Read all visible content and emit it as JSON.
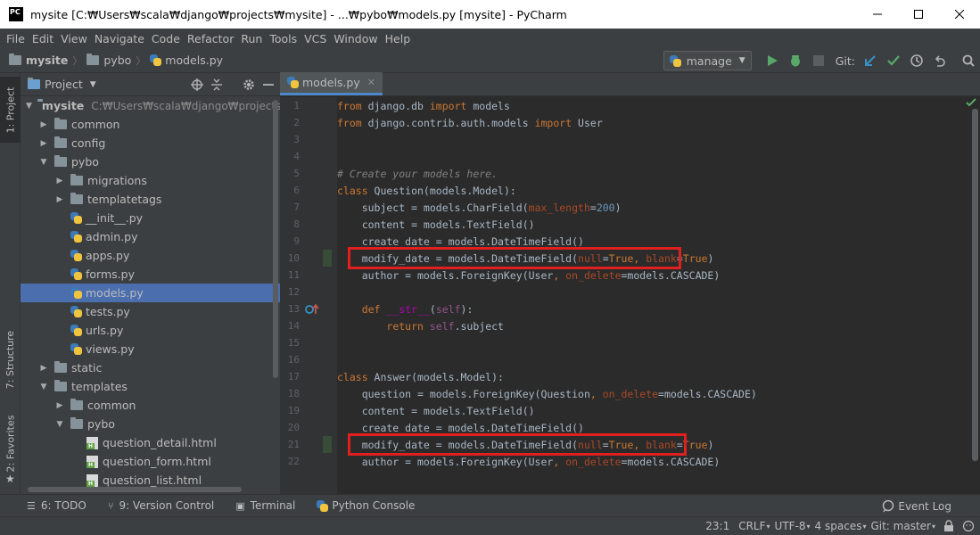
{
  "window": {
    "app_icon": "PC",
    "title": "mysite [C:₩Users₩scala₩django₩projects₩mysite] - ...₩pybo₩models.py [mysite] - PyCharm"
  },
  "menu": [
    "File",
    "Edit",
    "View",
    "Navigate",
    "Code",
    "Refactor",
    "Run",
    "Tools",
    "VCS",
    "Window",
    "Help"
  ],
  "breadcrumb": [
    "mysite",
    "pybo",
    "models.py"
  ],
  "toolbar": {
    "run_config": "manage",
    "git_label": "Git:"
  },
  "left_strip": {
    "project": "1: Project",
    "structure": "7: Structure",
    "favorites": "2: Favorites"
  },
  "project_panel": {
    "title": "Project",
    "root": {
      "name": "mysite",
      "path": "C:₩Users₩scala₩django₩projects₩mys"
    },
    "items": [
      {
        "label": "common"
      },
      {
        "label": "config"
      },
      {
        "label": "pybo"
      },
      {
        "label": "migrations"
      },
      {
        "label": "templatetags"
      },
      {
        "label": "__init__.py"
      },
      {
        "label": "admin.py"
      },
      {
        "label": "apps.py"
      },
      {
        "label": "forms.py"
      },
      {
        "label": "models.py"
      },
      {
        "label": "tests.py"
      },
      {
        "label": "urls.py"
      },
      {
        "label": "views.py"
      },
      {
        "label": "static"
      },
      {
        "label": "templates"
      },
      {
        "label": "common"
      },
      {
        "label": "pybo"
      },
      {
        "label": "question_detail.html"
      },
      {
        "label": "question_form.html"
      },
      {
        "label": "question_list.html"
      }
    ]
  },
  "editor": {
    "tab": "models.py",
    "line_numbers": [
      "1",
      "2",
      "3",
      "4",
      "5",
      "6",
      "7",
      "8",
      "9",
      "10",
      "11",
      "12",
      "13",
      "14",
      "15",
      "16",
      "17",
      "18",
      "19",
      "20",
      "21",
      "22"
    ],
    "code": {
      "l1a": "from",
      "l1b": " django.db ",
      "l1c": "import",
      "l1d": " models",
      "l2a": "from",
      "l2b": " django.contrib.auth.models ",
      "l2c": "import",
      "l2d": " User",
      "l5": "# Create your models here.",
      "l6a": "class",
      "l6b": " Question(models.Model):",
      "l7a": "    subject = models.CharField(",
      "l7b": "max_length",
      "l7c": "=",
      "l7d": "200",
      "l7e": ")",
      "l8": "    content = models.TextField()",
      "l9": "    create_date = models.DateTimeField()",
      "l10a": "    modify_date = models.DateTimeField(",
      "l10b": "null",
      "l10c": "=",
      "l10d": "True",
      "l10e": ", ",
      "l10f": "blank",
      "l10g": "=",
      "l10h": "True",
      "l10i": ")",
      "l11a": "    author = models.ForeignKey(User",
      "l11b": ", ",
      "l11c": "on_delete",
      "l11d": "=models.CASCADE)",
      "l13a": "    ",
      "l13b": "def",
      "l13c": " ",
      "l13d": "__str__",
      "l13e": "(",
      "l13f": "self",
      "l13g": "):",
      "l14a": "        ",
      "l14b": "return",
      "l14c": " ",
      "l14d": "self",
      "l14e": ".subject",
      "l17a": "class",
      "l17b": " Answer(models.Model):",
      "l18a": "    question = models.ForeignKey(Question",
      "l18b": ", ",
      "l18c": "on_delete",
      "l18d": "=models.CASCADE)",
      "l19": "    content = models.TextField()",
      "l20": "    create_date = models.DateTimeField()",
      "l21a": "    modify_date = models.DateTimeField(",
      "l21b": "null",
      "l21c": "=",
      "l21d": "True",
      "l21e": ", ",
      "l21f": "blank",
      "l21g": "=",
      "l21h": "True",
      "l21i": ")",
      "l22a": "    author = models.ForeignKey(User",
      "l22b": ", ",
      "l22c": "on_delete",
      "l22d": "=models.CASCADE)"
    }
  },
  "tool_windows": [
    {
      "label": "6: TODO",
      "icon": "todo-icon"
    },
    {
      "label": "9: Version Control",
      "icon": "vcs-icon"
    },
    {
      "label": "Terminal",
      "icon": "terminal-icon"
    },
    {
      "label": "Python Console",
      "icon": "python-console-icon"
    }
  ],
  "event_log": "Event Log",
  "status": {
    "position": "23:1",
    "line_sep": "CRLF",
    "encoding": "UTF-8",
    "indent": "4 spaces",
    "git_branch": "Git: master"
  }
}
